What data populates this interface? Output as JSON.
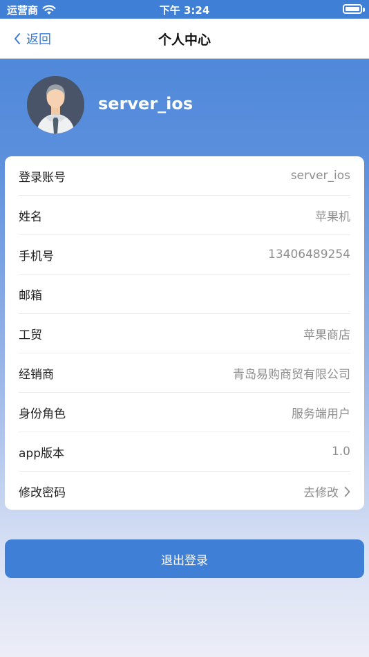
{
  "status_bar": {
    "carrier": "运营商",
    "time": "下午 3:24"
  },
  "nav": {
    "back_label": "返回",
    "title": "个人中心"
  },
  "profile": {
    "username": "server_ios"
  },
  "info_rows": [
    {
      "label": "登录账号",
      "value": "server_ios"
    },
    {
      "label": "姓名",
      "value": "苹果机"
    },
    {
      "label": "手机号",
      "value": "13406489254"
    },
    {
      "label": "邮箱",
      "value": ""
    },
    {
      "label": "工贸",
      "value": "苹果商店"
    },
    {
      "label": "经销商",
      "value": "青岛易购商贸有限公司"
    },
    {
      "label": "身份角色",
      "value": "服务端用户"
    },
    {
      "label": "app版本",
      "value": "1.0"
    },
    {
      "label": "修改密码",
      "value": "去修改"
    }
  ],
  "logout_label": "退出登录",
  "colors": {
    "primary": "#3f7fd6",
    "nav_back": "#3a7bd5",
    "value_gray": "#8e8e8e"
  }
}
